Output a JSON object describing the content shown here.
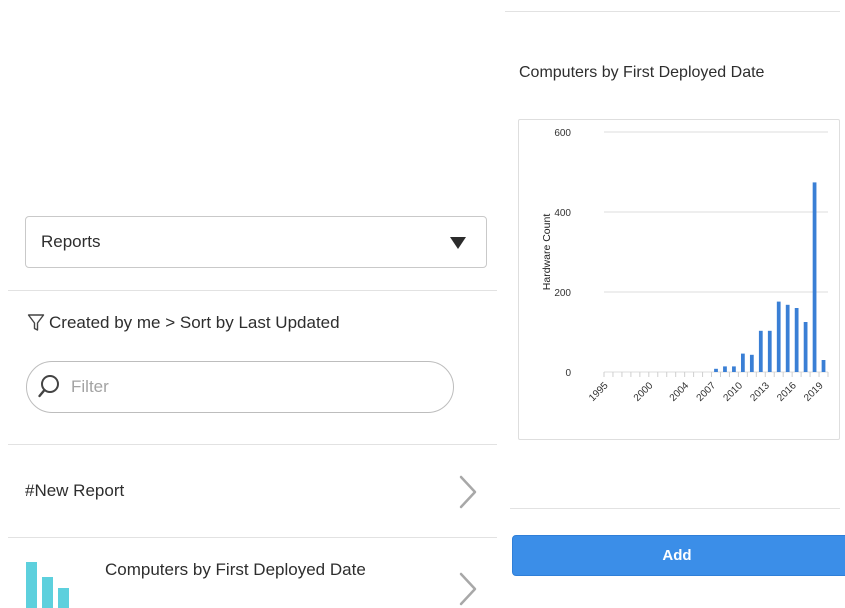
{
  "left_panel": {
    "report_type_select": {
      "value": "Reports"
    },
    "filter_breadcrumb": "Created by me > Sort by Last Updated",
    "search": {
      "placeholder": "Filter"
    },
    "items": [
      {
        "label": "#New Report"
      },
      {
        "label": "Computers by First Deployed Date",
        "icon": "bar-chart-icon",
        "icon_color": "#5dd0dd"
      }
    ]
  },
  "preview": {
    "title": "Computers by First Deployed Date",
    "add_button": "Add",
    "accent_color": "#3b8ee8"
  },
  "chart_data": {
    "type": "bar",
    "ylabel": "Hardware Count",
    "ylim": [
      0,
      600
    ],
    "yticks": [
      0,
      200,
      400,
      600
    ],
    "grid": true,
    "bar_color": "#3a7fd5",
    "xtick_labels": [
      "1995",
      "2000",
      "2004",
      "2007",
      "2010",
      "2013",
      "2016",
      "2019"
    ],
    "xtick_index": [
      0,
      5,
      9,
      12,
      15,
      18,
      21,
      24
    ],
    "categories": [
      "1995",
      "1996",
      "1997",
      "1998",
      "1999",
      "2000",
      "2001",
      "2002",
      "2003",
      "2004",
      "2005",
      "2006",
      "2007",
      "2008",
      "2009",
      "2010",
      "2011",
      "2012",
      "2013",
      "2014",
      "2015",
      "2016",
      "2017",
      "2018",
      "2019"
    ],
    "values": [
      0,
      0,
      0,
      0,
      0,
      0,
      0,
      0,
      0,
      0,
      0,
      0,
      8,
      14,
      14,
      46,
      43,
      103,
      103,
      176,
      168,
      160,
      125,
      474,
      30
    ]
  }
}
